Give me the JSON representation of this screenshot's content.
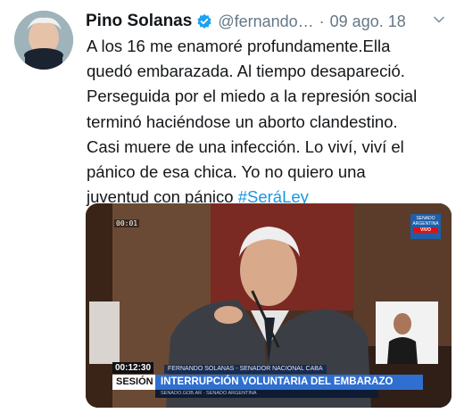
{
  "tweet": {
    "author_name": "Pino Solanas",
    "handle": "@fernando…",
    "separator": "·",
    "date": "09 ago. 18",
    "text_lines": [
      "A los 16 me enamoré profundamente.Ella",
      "quedó embarazada. Al tiempo desapareció.",
      "Perseguida por el miedo a la represión social",
      "terminó haciéndose un aborto clandestino.",
      "Casi muere de una infección. Lo viví, viví el",
      "pánico de esa chica. Yo no quiero una",
      "juventud con pánico "
    ],
    "hashtag": "#SeráLey",
    "icons": {
      "verified": "verified-badge-icon",
      "menu": "chevron-down-icon"
    },
    "colors": {
      "link": "#1b95e0",
      "verified": "#1da1f2",
      "secondary_text": "#657786"
    }
  },
  "media": {
    "counter": "00:01",
    "tv_logo": "SENADO ARGENTINA",
    "tv_logo_live": "VIVO",
    "timecode": "00:12:30",
    "speaker_caption": "FERNANDO SOLANAS - SENADOR NACIONAL CABA",
    "section_label": "SESIÓN",
    "headline": "INTERRUPCIÓN VOLUNTARIA DEL EMBARAZO",
    "subline": "SENADO.GOB.AR  ·  SENADO ARGENTINA"
  }
}
